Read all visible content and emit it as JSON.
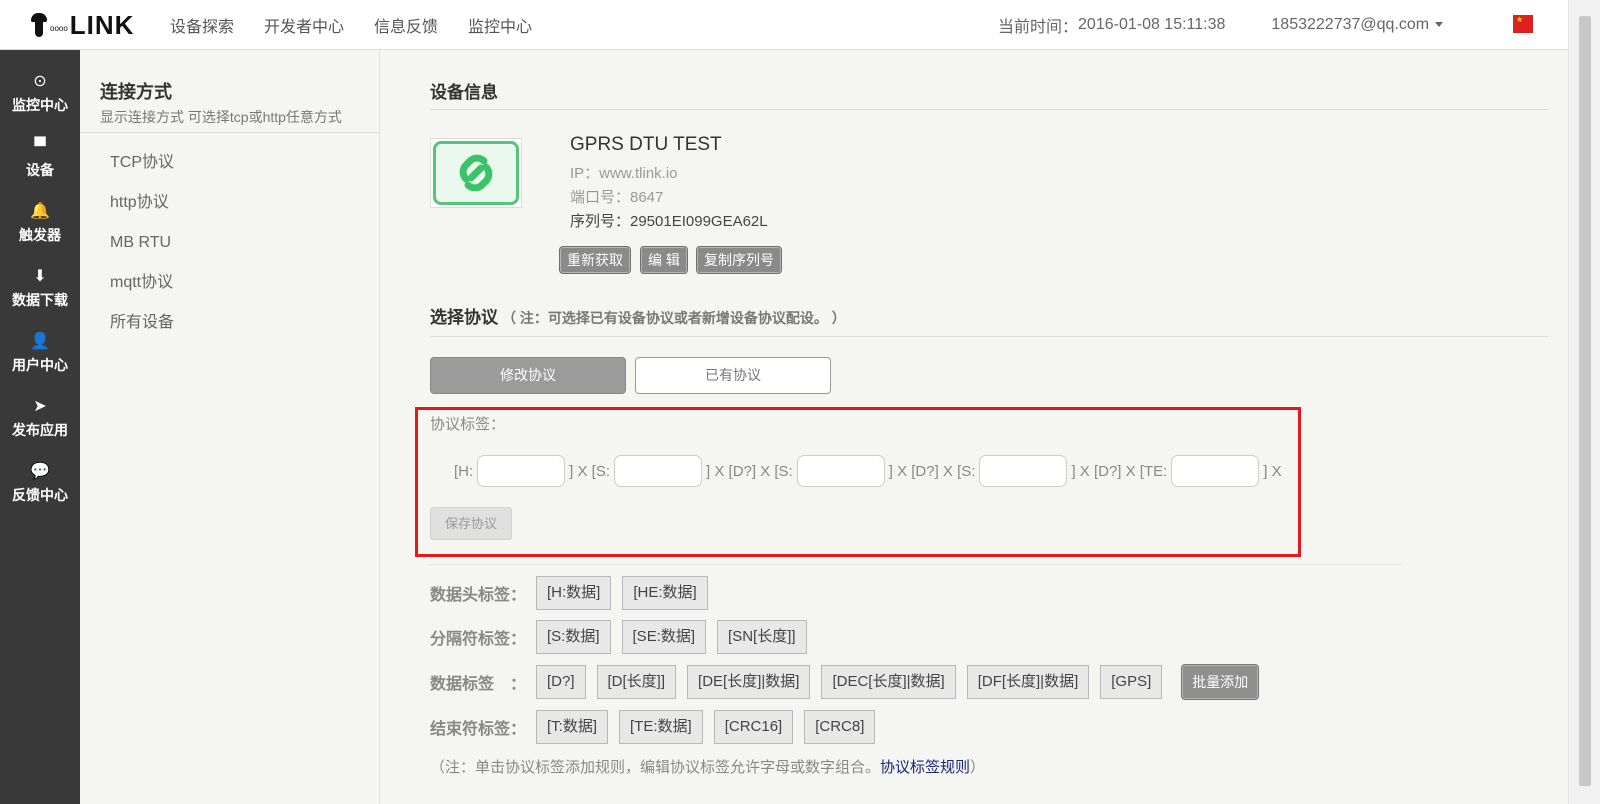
{
  "topbar": {
    "logo_text": "LINK",
    "logo_dots": "oooo",
    "nav": [
      "设备探索",
      "开发者中心",
      "信息反馈",
      "监控中心"
    ],
    "time_label": "当前时间：",
    "time_value": "2016-01-08 15:11:38",
    "user_email": "1853222737@qq.com",
    "language_flag": "china-flag"
  },
  "rail": [
    {
      "icon": "monitor-target-icon",
      "glyph": "⊙",
      "label": "监控中心"
    },
    {
      "icon": "device-icon",
      "glyph": "▀",
      "label": "设备"
    },
    {
      "icon": "bell-icon",
      "glyph": "🔔",
      "label": "触发器"
    },
    {
      "icon": "download-arrow-icon",
      "glyph": "⬇",
      "label": "数据下载"
    },
    {
      "icon": "user-icon",
      "glyph": "👤",
      "label": "用户中心"
    },
    {
      "icon": "send-plane-icon",
      "glyph": "➤",
      "label": "发布应用"
    },
    {
      "icon": "comment-icon",
      "glyph": "💬",
      "label": "反馈中心"
    }
  ],
  "subpanel": {
    "title": "连接方式",
    "desc": "显示连接方式 可选择tcp或http任意方式",
    "items": [
      "TCP协议",
      "http协议",
      "MB RTU",
      "mqtt协议",
      "所有设备"
    ]
  },
  "device": {
    "section_title": "设备信息",
    "name": "GPRS DTU TEST",
    "ip": "IP：www.tlink.io",
    "port": "端口号：8647",
    "serial": "序列号：29501EI099GEA62L",
    "buttons": [
      "重新获取",
      "编 辑",
      "复制序列号"
    ]
  },
  "protocol": {
    "section_title": "选择协议",
    "section_note": "（ 注：可选择已有设备协议或者新增设备协议配设。 ）",
    "tabs": [
      "修改协议",
      "已有协议"
    ],
    "label": "协议标签：",
    "segments": [
      "[H:",
      "] X [S:",
      "] X [D?] X [S:",
      "] X [D?] X [S:",
      "] X [D?] X [TE:",
      "] X"
    ],
    "inputs": [
      "",
      "",
      "",
      "",
      ""
    ],
    "save_label": "保存协议"
  },
  "tags": {
    "rows": [
      {
        "label": "数据头标签：",
        "items": [
          "[H:数据]",
          "[HE:数据]"
        ]
      },
      {
        "label": "分隔符标签：",
        "items": [
          "[S:数据]",
          "[SE:数据]",
          "[SN[长度]]"
        ]
      },
      {
        "label": "数据标签　：",
        "items": [
          "[D?]",
          "[D[长度]]",
          "[DE[长度]|数据]",
          "[DEC[长度]|数据]",
          "[DF[长度]|数据]",
          "[GPS]"
        ],
        "extra": "批量添加"
      },
      {
        "label": "结束符标签：",
        "items": [
          "[T:数据]",
          "[TE:数据]",
          "[CRC16]",
          "[CRC8]"
        ]
      }
    ],
    "note_prefix": "（注：单击协议标签添加规则，编辑协议标签允许字母或数字组合。",
    "note_link": "协议标签规则",
    "note_suffix": "）"
  }
}
